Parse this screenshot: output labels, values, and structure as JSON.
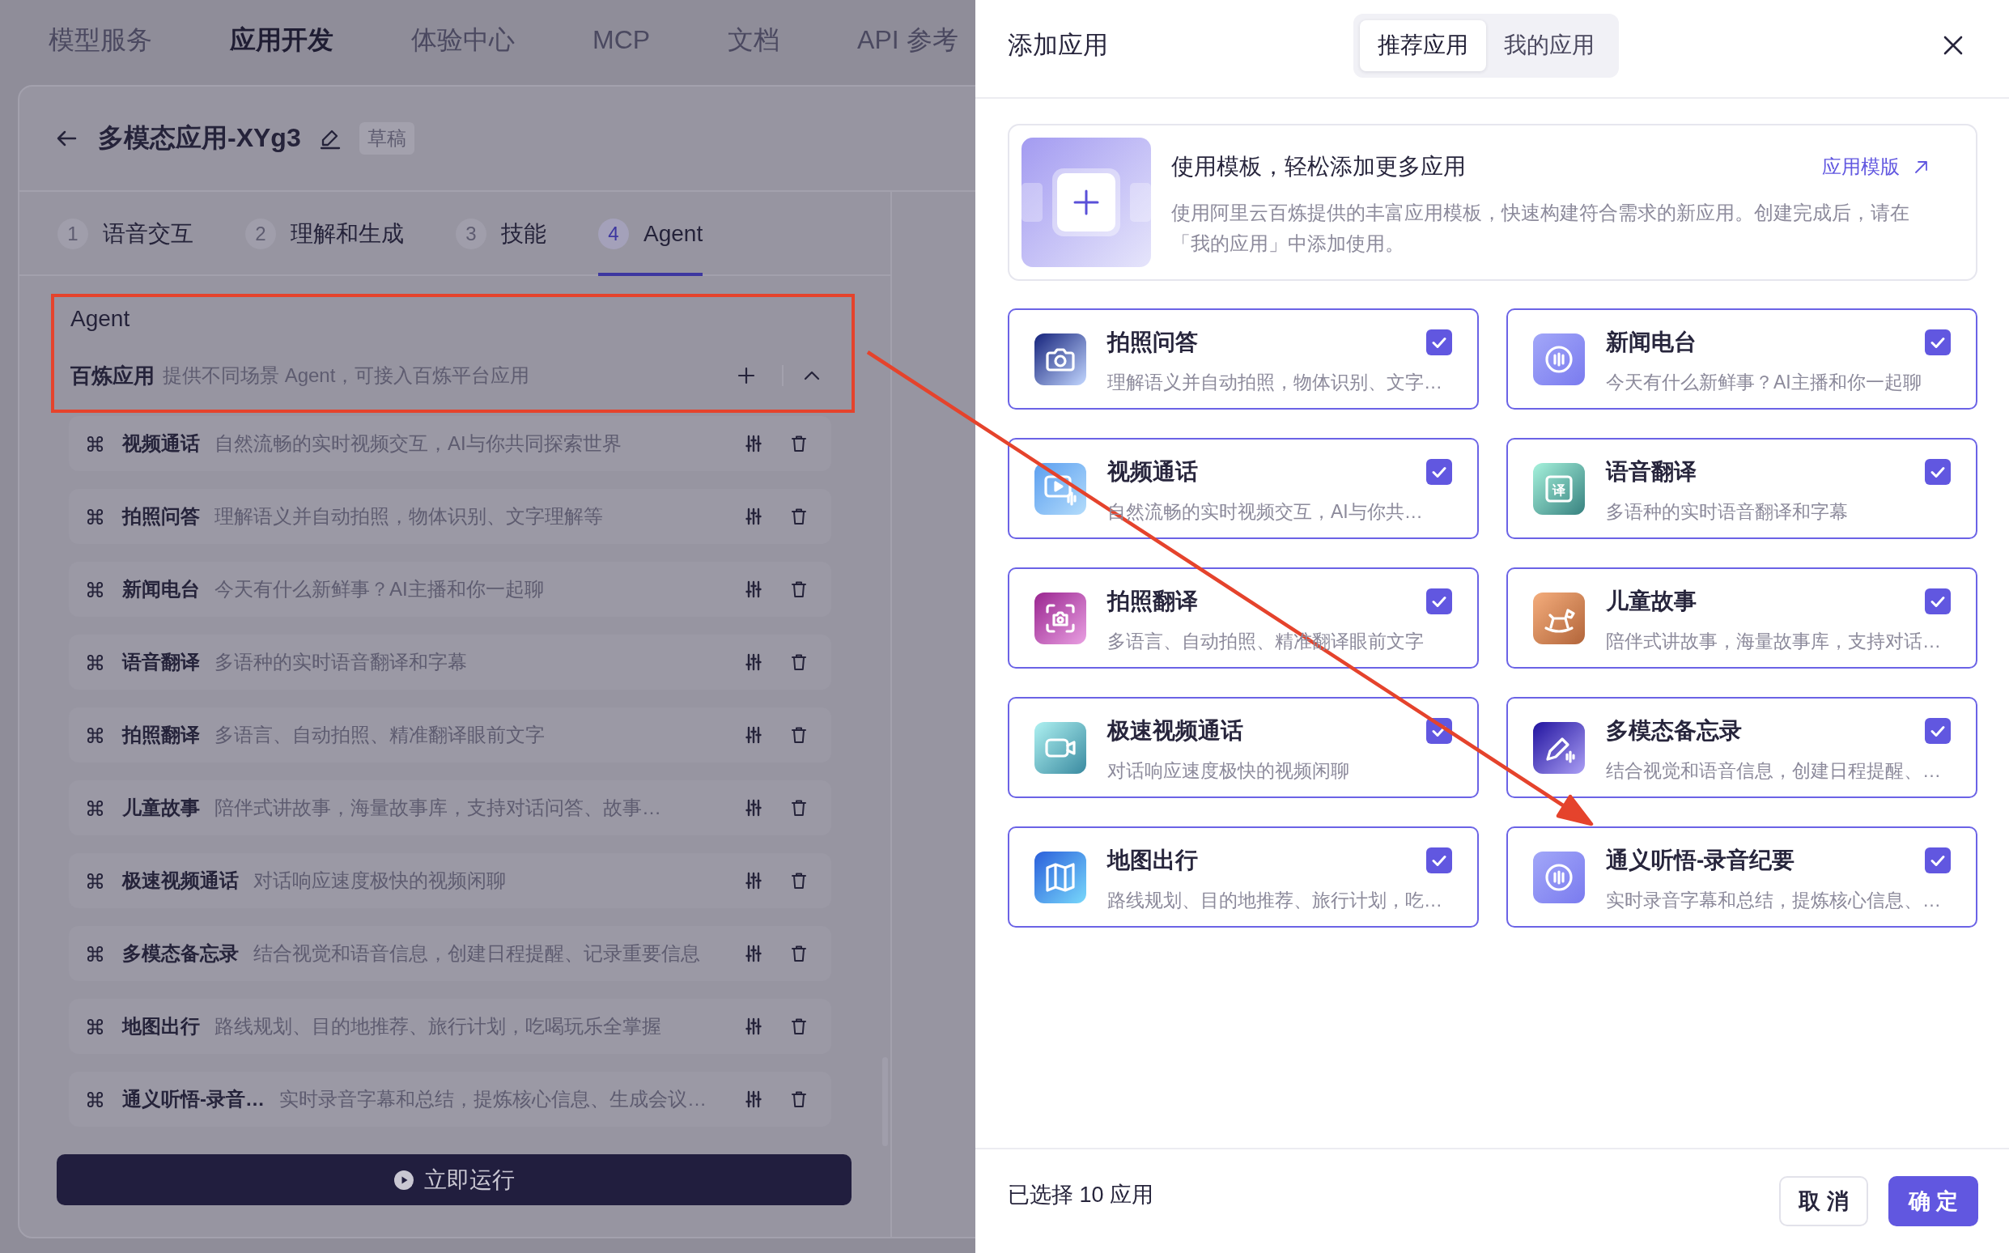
{
  "top_nav": [
    {
      "label": "模型服务",
      "selected": false
    },
    {
      "label": "应用开发",
      "selected": true
    },
    {
      "label": "体验中心",
      "selected": false
    },
    {
      "label": "MCP",
      "selected": false
    },
    {
      "label": "文档",
      "selected": false
    },
    {
      "label": "API 参考",
      "selected": false
    }
  ],
  "app_header": {
    "title": "多模态应用-XYg3",
    "status": "草稿"
  },
  "steps": [
    {
      "number": "1",
      "label": "语音交互",
      "selected": false
    },
    {
      "number": "2",
      "label": "理解和生成",
      "selected": false
    },
    {
      "number": "3",
      "label": "技能",
      "selected": false
    },
    {
      "number": "4",
      "label": "Agent",
      "selected": true
    }
  ],
  "agent_section": {
    "title": "Agent",
    "source": {
      "name": "百炼应用",
      "description": "提供不同场景 Agent，可接入百炼平台应用"
    },
    "apps": [
      {
        "name": "视频通话",
        "description": "自然流畅的实时视频交互，AI与你共同探索世界"
      },
      {
        "name": "拍照问答",
        "description": "理解语义并自动拍照，物体识别、文字理解等"
      },
      {
        "name": "新闻电台",
        "description": "今天有什么新鲜事？AI主播和你一起聊"
      },
      {
        "name": "语音翻译",
        "description": "多语种的实时语音翻译和字幕"
      },
      {
        "name": "拍照翻译",
        "description": "多语言、自动拍照、精准翻译眼前文字"
      },
      {
        "name": "儿童故事",
        "description": "陪伴式讲故事，海量故事库，支持对话问答、故事…"
      },
      {
        "name": "极速视频通话",
        "description": "对话响应速度极快的视频闲聊"
      },
      {
        "name": "多模态备忘录",
        "description": "结合视觉和语音信息，创建日程提醒、记录重要信息"
      },
      {
        "name": "地图出行",
        "description": "路线规划、目的地推荐、旅行计划，吃喝玩乐全掌握"
      },
      {
        "name": "通义听悟-录音…",
        "description": "实时录音字幕和总结，提炼核心信息、生成会议…"
      }
    ]
  },
  "run_button": {
    "label": "立即运行"
  },
  "dialog": {
    "title": "添加应用",
    "tabs": [
      {
        "label": "推荐应用",
        "selected": true
      },
      {
        "label": "我的应用",
        "selected": false
      }
    ],
    "template_banner": {
      "title": "使用模板，轻松添加更多应用",
      "link": "应用模版",
      "description": "使用阿里云百炼提供的丰富应用模板，快速构建符合需求的新应用。创建完成后，请在「我的应用」中添加使用。"
    },
    "apps": [
      {
        "name": "拍照问答",
        "description": "理解语义并自动拍照，物体识别、文字…",
        "kind": "camera",
        "checked": true
      },
      {
        "name": "新闻电台",
        "description": "今天有什么新鲜事？AI主播和你一起聊",
        "kind": "wave",
        "checked": true
      },
      {
        "name": "视频通话",
        "description": "自然流畅的实时视频交互，AI与你共…",
        "kind": "video",
        "checked": true
      },
      {
        "name": "语音翻译",
        "description": "多语种的实时语音翻译和字幕",
        "kind": "translate",
        "icon_glyph": "译",
        "checked": true
      },
      {
        "name": "拍照翻译",
        "description": "多语言、自动拍照、精准翻译眼前文字",
        "kind": "scan",
        "checked": true
      },
      {
        "name": "儿童故事",
        "description": "陪伴式讲故事，海量故事库，支持对话…",
        "kind": "horse",
        "checked": true
      },
      {
        "name": "极速视频通话",
        "description": "对话响应速度极快的视频闲聊",
        "kind": "camcorder",
        "checked": true
      },
      {
        "name": "多模态备忘录",
        "description": "结合视觉和语音信息，创建日程提醒、…",
        "kind": "pen",
        "checked": true
      },
      {
        "name": "地图出行",
        "description": "路线规划、目的地推荐、旅行计划，吃…",
        "kind": "map",
        "checked": true
      },
      {
        "name": "通义听悟-录音纪要",
        "description": "实时录音字幕和总结，提炼核心信息、…",
        "kind": "wave",
        "checked": true
      }
    ],
    "footer": {
      "selection": "已选择 10 应用",
      "cancel": "取 消",
      "confirm": "确 定"
    }
  }
}
